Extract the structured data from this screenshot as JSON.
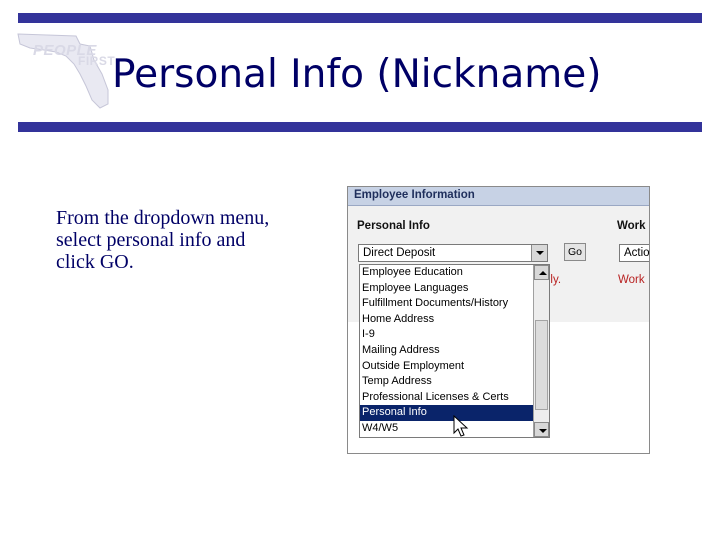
{
  "logo": {
    "word1": "PEOPLE",
    "word2": "FIRST"
  },
  "slide": {
    "title": "Personal Info (Nickname)",
    "body": "From the dropdown menu, select personal info and click GO."
  },
  "screenshot": {
    "header": "Employee Information",
    "personal_label": "Personal Info",
    "work_label": "Work",
    "select_value": "Direct Deposit",
    "go_label": "Go",
    "action_value": "Actio",
    "red_note_left": "nly.",
    "red_note_right": "Work",
    "options": [
      "Employee Education",
      "Employee Languages",
      "Fulfillment Documents/History",
      "Home Address",
      "I-9",
      "Mailing Address",
      "Outside Employment",
      "Temp Address",
      "Professional Licenses & Certs",
      "Personal Info",
      "W4/W5"
    ],
    "selected_option": "Personal Info"
  },
  "colors": {
    "bar": "#33339a",
    "title": "#000066",
    "selection": "#0a246a",
    "note_red": "#b82222"
  },
  "icons": [
    "florida-map-logo",
    "dropdown-arrow-icon",
    "scroll-up-icon",
    "scroll-down-icon",
    "mouse-cursor-icon"
  ]
}
